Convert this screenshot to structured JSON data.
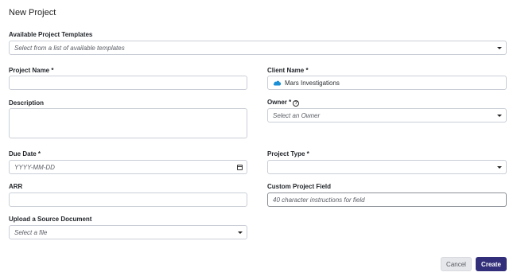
{
  "page": {
    "title": "New Project"
  },
  "templates": {
    "label": "Available Project Templates",
    "placeholder": "Select from a list of available templates"
  },
  "project_name": {
    "label": "Project Name *",
    "value": ""
  },
  "client_name": {
    "label": "Client Name *",
    "value": "Mars Investigations",
    "icon": "cloud-icon",
    "icon_color": "#1a8fd6"
  },
  "description": {
    "label": "Description",
    "value": ""
  },
  "owner": {
    "label": "Owner *",
    "help_icon": "?",
    "placeholder": "Select an Owner"
  },
  "due_date": {
    "label": "Due Date *",
    "placeholder": "YYYY-MM-DD"
  },
  "project_type": {
    "label": "Project Type *",
    "value": ""
  },
  "arr": {
    "label": "ARR",
    "value": ""
  },
  "custom_field": {
    "label": "Custom Project Field",
    "placeholder": "40 character instructions for field"
  },
  "source_doc": {
    "label": "Upload a Source Document",
    "placeholder": "Select a file"
  },
  "actions": {
    "cancel": "Cancel",
    "create": "Create"
  },
  "colors": {
    "primary": "#322e7a",
    "cancel_bg": "#e6e7eb"
  }
}
